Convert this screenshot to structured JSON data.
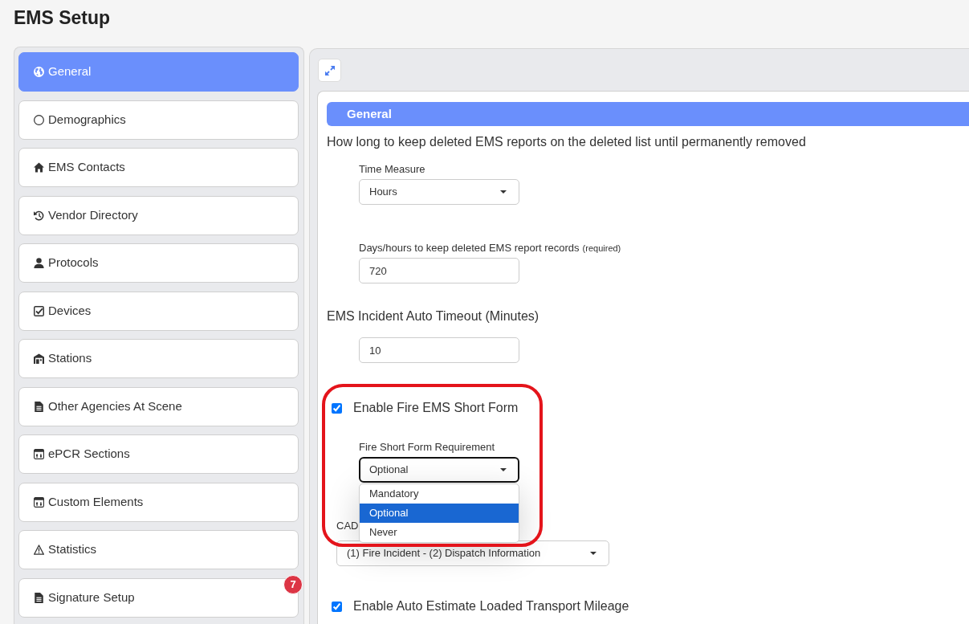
{
  "page": {
    "title": "EMS Setup"
  },
  "sidebar": {
    "items": [
      {
        "label": "General",
        "selected": true
      },
      {
        "label": "Demographics",
        "selected": false
      },
      {
        "label": "EMS Contacts",
        "selected": false
      },
      {
        "label": "Vendor Directory",
        "selected": false
      },
      {
        "label": "Protocols",
        "selected": false
      },
      {
        "label": "Devices",
        "selected": false
      },
      {
        "label": "Stations",
        "selected": false
      },
      {
        "label": "Other Agencies At Scene",
        "selected": false
      },
      {
        "label": "ePCR Sections",
        "selected": false
      },
      {
        "label": "Custom Elements",
        "selected": false
      },
      {
        "label": "Statistics",
        "selected": false
      },
      {
        "label": "Signature Setup",
        "selected": false,
        "badge": "7"
      }
    ]
  },
  "form": {
    "section_title": "General",
    "blocks": [
      {
        "kind": "text",
        "text": "How long to keep deleted EMS reports on the deleted list until permanently removed"
      },
      {
        "kind": "select",
        "label": "Time Measure",
        "value": "Hours",
        "expanded": false
      },
      {
        "kind": "input",
        "label": "Days/hours to keep deleted EMS report records",
        "note": "(required)",
        "value": "720"
      },
      {
        "kind": "text",
        "text": "EMS Incident Auto Timeout (Minutes)"
      },
      {
        "kind": "input",
        "value": "10"
      },
      {
        "kind": "checkbox",
        "label": "Enable Fire EMS Short Form",
        "checked": true,
        "highlighted": true
      },
      {
        "kind": "select",
        "label": "Fire Short Form Requirement",
        "value": "Optional",
        "expanded": true,
        "options": [
          {
            "label": "Mandatory",
            "selected": false
          },
          {
            "label": "Optional",
            "selected": true
          },
          {
            "label": "Never",
            "selected": false
          }
        ]
      },
      {
        "kind": "wide_select",
        "label": "CAD",
        "value": "(1) Fire Incident - (2) Dispatch Information",
        "expanded": false
      },
      {
        "kind": "checkbox",
        "label": "Enable Auto Estimate Loaded Transport Mileage",
        "checked": true,
        "highlighted": false
      }
    ]
  }
}
